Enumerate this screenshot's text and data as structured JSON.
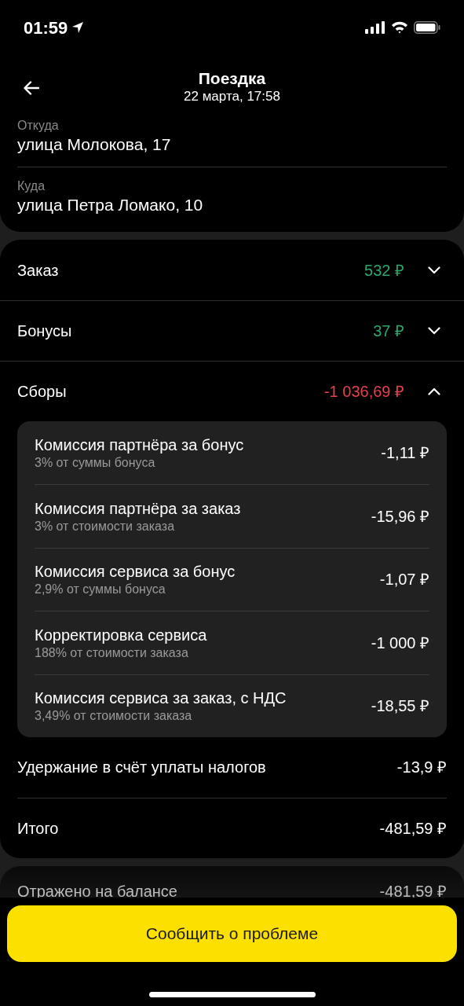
{
  "status_bar": {
    "time": "01:59"
  },
  "header": {
    "title": "Поездка",
    "subtitle": "22 марта, 17:58"
  },
  "route": [
    {
      "label": "Откуда",
      "address": "улица Молокова, 17"
    },
    {
      "label": "Куда",
      "address": "улица Петра Ломако, 10"
    }
  ],
  "sections": [
    {
      "label": "Заказ",
      "amount": "532 ₽",
      "color": "#2ea66b",
      "expanded": false
    },
    {
      "label": "Бонусы",
      "amount": "37 ₽",
      "color": "#2ea66b",
      "expanded": false
    },
    {
      "label": "Сборы",
      "amount": "-1 036,69 ₽",
      "color": "#e5404f",
      "expanded": true,
      "items": [
        {
          "title": "Комиссия партнёра за бонус",
          "note": "3% от суммы бонуса",
          "amount": "-1,11 ₽"
        },
        {
          "title": "Комиссия партнёра за заказ",
          "note": "3% от стоимости заказа",
          "amount": "-15,96 ₽"
        },
        {
          "title": "Комиссия сервиса за бонус",
          "note": "2,9% от суммы бонуса",
          "amount": "-1,07 ₽"
        },
        {
          "title": "Корректировка сервиса",
          "note": "188% от стоимости заказа",
          "amount": "-1 000 ₽"
        },
        {
          "title": "Комиссия сервиса за заказ, с НДС",
          "note": "3,49% от стоимости заказа",
          "amount": "-18,55 ₽"
        }
      ]
    }
  ],
  "totals": [
    {
      "label": "Удержание в счёт уплаты налогов",
      "amount": "-13,9 ₽"
    },
    {
      "label": "Итого",
      "amount": "-481,59 ₽"
    }
  ],
  "balance": {
    "label": "Отражено на балансе",
    "amount": "-481,59 ₽"
  },
  "report_button": "Сообщить о проблеме"
}
